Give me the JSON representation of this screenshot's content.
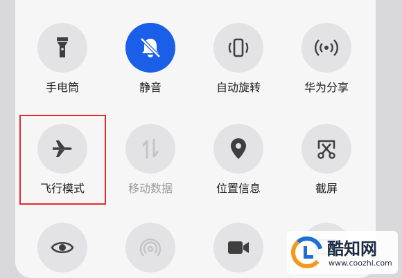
{
  "colors": {
    "panel": "#f6f6f7",
    "tile_off": "#e3e3e5",
    "tile_on": "#1b5fe8",
    "highlight_border": "#e22c2c"
  },
  "tiles": [
    {
      "label": "手电筒",
      "icon": "flashlight-icon",
      "active": false
    },
    {
      "label": "静音",
      "icon": "bell-off-icon",
      "active": true
    },
    {
      "label": "自动旋转",
      "icon": "auto-rotate-icon",
      "active": false
    },
    {
      "label": "华为分享",
      "icon": "share-icon",
      "active": false
    },
    {
      "label": "飞行模式",
      "icon": "airplane-icon",
      "active": false
    },
    {
      "label": "移动数据",
      "icon": "mobile-data-icon",
      "active": false,
      "disabled": true
    },
    {
      "label": "位置信息",
      "icon": "location-icon",
      "active": false
    },
    {
      "label": "截屏",
      "icon": "screenshot-icon",
      "active": false
    },
    {
      "label": "",
      "icon": "eye-icon",
      "active": false
    },
    {
      "label": "",
      "icon": "hotspot-icon",
      "active": false
    },
    {
      "label": "",
      "icon": "screen-record-icon",
      "active": false
    },
    {
      "label": "",
      "icon": "cast-icon",
      "active": false
    }
  ],
  "watermark": {
    "title": "酷知网",
    "url": "www.coozhi.com"
  }
}
